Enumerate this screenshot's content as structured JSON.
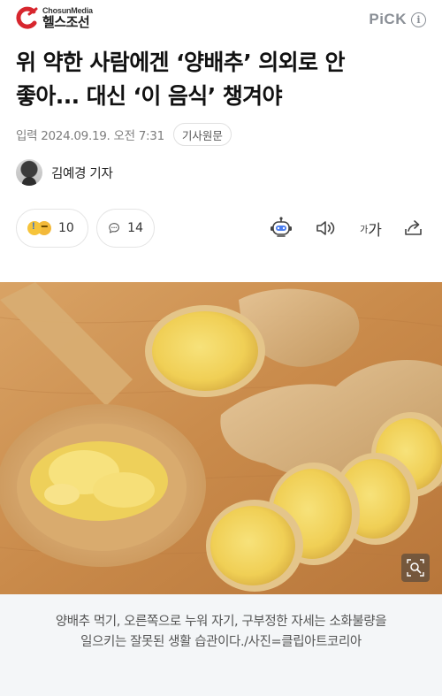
{
  "header": {
    "logo_en": "ChosunMedia",
    "logo_ko": "헬스조선",
    "pick_label": "PiCK",
    "info_symbol": "i",
    "brand_color": "#d7262e"
  },
  "article": {
    "title_line1": "위 약한 사람에겐 ‘양배추’ 의외로 안",
    "title_line2": "좋아... 대신 ‘이 음식’ 챙겨야",
    "date": "입력 2024.09.19. 오전 7:31",
    "origin_button": "기사원문",
    "author": "김예경 기자"
  },
  "actions": {
    "reaction_count": "10",
    "comment_count": "14",
    "font_size_label_small": "가",
    "font_size_label_large": "가",
    "icons": [
      "emoji-reaction-icon",
      "comment-icon",
      "summary-bot-icon",
      "speaker-icon",
      "font-size-icon",
      "share-icon"
    ]
  },
  "photo": {
    "alt": "",
    "zoom_icon": "zoom-icon"
  },
  "caption": {
    "line1": "양배추 먹기, 오른쪽으로 누워 자기, 구부정한 자세는 소화불량을",
    "line2": "일으키는 잘못된 생활 습관이다./사진=클립아트코리아"
  }
}
